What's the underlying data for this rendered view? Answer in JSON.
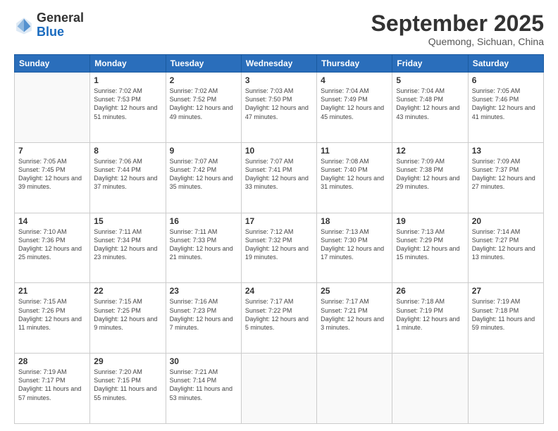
{
  "logo": {
    "general": "General",
    "blue": "Blue"
  },
  "header": {
    "month": "September 2025",
    "location": "Quemong, Sichuan, China"
  },
  "weekdays": [
    "Sunday",
    "Monday",
    "Tuesday",
    "Wednesday",
    "Thursday",
    "Friday",
    "Saturday"
  ],
  "weeks": [
    [
      {
        "day": "",
        "sunrise": "",
        "sunset": "",
        "daylight": ""
      },
      {
        "day": "1",
        "sunrise": "Sunrise: 7:02 AM",
        "sunset": "Sunset: 7:53 PM",
        "daylight": "Daylight: 12 hours and 51 minutes."
      },
      {
        "day": "2",
        "sunrise": "Sunrise: 7:02 AM",
        "sunset": "Sunset: 7:52 PM",
        "daylight": "Daylight: 12 hours and 49 minutes."
      },
      {
        "day": "3",
        "sunrise": "Sunrise: 7:03 AM",
        "sunset": "Sunset: 7:50 PM",
        "daylight": "Daylight: 12 hours and 47 minutes."
      },
      {
        "day": "4",
        "sunrise": "Sunrise: 7:04 AM",
        "sunset": "Sunset: 7:49 PM",
        "daylight": "Daylight: 12 hours and 45 minutes."
      },
      {
        "day": "5",
        "sunrise": "Sunrise: 7:04 AM",
        "sunset": "Sunset: 7:48 PM",
        "daylight": "Daylight: 12 hours and 43 minutes."
      },
      {
        "day": "6",
        "sunrise": "Sunrise: 7:05 AM",
        "sunset": "Sunset: 7:46 PM",
        "daylight": "Daylight: 12 hours and 41 minutes."
      }
    ],
    [
      {
        "day": "7",
        "sunrise": "Sunrise: 7:05 AM",
        "sunset": "Sunset: 7:45 PM",
        "daylight": "Daylight: 12 hours and 39 minutes."
      },
      {
        "day": "8",
        "sunrise": "Sunrise: 7:06 AM",
        "sunset": "Sunset: 7:44 PM",
        "daylight": "Daylight: 12 hours and 37 minutes."
      },
      {
        "day": "9",
        "sunrise": "Sunrise: 7:07 AM",
        "sunset": "Sunset: 7:42 PM",
        "daylight": "Daylight: 12 hours and 35 minutes."
      },
      {
        "day": "10",
        "sunrise": "Sunrise: 7:07 AM",
        "sunset": "Sunset: 7:41 PM",
        "daylight": "Daylight: 12 hours and 33 minutes."
      },
      {
        "day": "11",
        "sunrise": "Sunrise: 7:08 AM",
        "sunset": "Sunset: 7:40 PM",
        "daylight": "Daylight: 12 hours and 31 minutes."
      },
      {
        "day": "12",
        "sunrise": "Sunrise: 7:09 AM",
        "sunset": "Sunset: 7:38 PM",
        "daylight": "Daylight: 12 hours and 29 minutes."
      },
      {
        "day": "13",
        "sunrise": "Sunrise: 7:09 AM",
        "sunset": "Sunset: 7:37 PM",
        "daylight": "Daylight: 12 hours and 27 minutes."
      }
    ],
    [
      {
        "day": "14",
        "sunrise": "Sunrise: 7:10 AM",
        "sunset": "Sunset: 7:36 PM",
        "daylight": "Daylight: 12 hours and 25 minutes."
      },
      {
        "day": "15",
        "sunrise": "Sunrise: 7:11 AM",
        "sunset": "Sunset: 7:34 PM",
        "daylight": "Daylight: 12 hours and 23 minutes."
      },
      {
        "day": "16",
        "sunrise": "Sunrise: 7:11 AM",
        "sunset": "Sunset: 7:33 PM",
        "daylight": "Daylight: 12 hours and 21 minutes."
      },
      {
        "day": "17",
        "sunrise": "Sunrise: 7:12 AM",
        "sunset": "Sunset: 7:32 PM",
        "daylight": "Daylight: 12 hours and 19 minutes."
      },
      {
        "day": "18",
        "sunrise": "Sunrise: 7:13 AM",
        "sunset": "Sunset: 7:30 PM",
        "daylight": "Daylight: 12 hours and 17 minutes."
      },
      {
        "day": "19",
        "sunrise": "Sunrise: 7:13 AM",
        "sunset": "Sunset: 7:29 PM",
        "daylight": "Daylight: 12 hours and 15 minutes."
      },
      {
        "day": "20",
        "sunrise": "Sunrise: 7:14 AM",
        "sunset": "Sunset: 7:27 PM",
        "daylight": "Daylight: 12 hours and 13 minutes."
      }
    ],
    [
      {
        "day": "21",
        "sunrise": "Sunrise: 7:15 AM",
        "sunset": "Sunset: 7:26 PM",
        "daylight": "Daylight: 12 hours and 11 minutes."
      },
      {
        "day": "22",
        "sunrise": "Sunrise: 7:15 AM",
        "sunset": "Sunset: 7:25 PM",
        "daylight": "Daylight: 12 hours and 9 minutes."
      },
      {
        "day": "23",
        "sunrise": "Sunrise: 7:16 AM",
        "sunset": "Sunset: 7:23 PM",
        "daylight": "Daylight: 12 hours and 7 minutes."
      },
      {
        "day": "24",
        "sunrise": "Sunrise: 7:17 AM",
        "sunset": "Sunset: 7:22 PM",
        "daylight": "Daylight: 12 hours and 5 minutes."
      },
      {
        "day": "25",
        "sunrise": "Sunrise: 7:17 AM",
        "sunset": "Sunset: 7:21 PM",
        "daylight": "Daylight: 12 hours and 3 minutes."
      },
      {
        "day": "26",
        "sunrise": "Sunrise: 7:18 AM",
        "sunset": "Sunset: 7:19 PM",
        "daylight": "Daylight: 12 hours and 1 minute."
      },
      {
        "day": "27",
        "sunrise": "Sunrise: 7:19 AM",
        "sunset": "Sunset: 7:18 PM",
        "daylight": "Daylight: 11 hours and 59 minutes."
      }
    ],
    [
      {
        "day": "28",
        "sunrise": "Sunrise: 7:19 AM",
        "sunset": "Sunset: 7:17 PM",
        "daylight": "Daylight: 11 hours and 57 minutes."
      },
      {
        "day": "29",
        "sunrise": "Sunrise: 7:20 AM",
        "sunset": "Sunset: 7:15 PM",
        "daylight": "Daylight: 11 hours and 55 minutes."
      },
      {
        "day": "30",
        "sunrise": "Sunrise: 7:21 AM",
        "sunset": "Sunset: 7:14 PM",
        "daylight": "Daylight: 11 hours and 53 minutes."
      },
      {
        "day": "",
        "sunrise": "",
        "sunset": "",
        "daylight": ""
      },
      {
        "day": "",
        "sunrise": "",
        "sunset": "",
        "daylight": ""
      },
      {
        "day": "",
        "sunrise": "",
        "sunset": "",
        "daylight": ""
      },
      {
        "day": "",
        "sunrise": "",
        "sunset": "",
        "daylight": ""
      }
    ]
  ]
}
